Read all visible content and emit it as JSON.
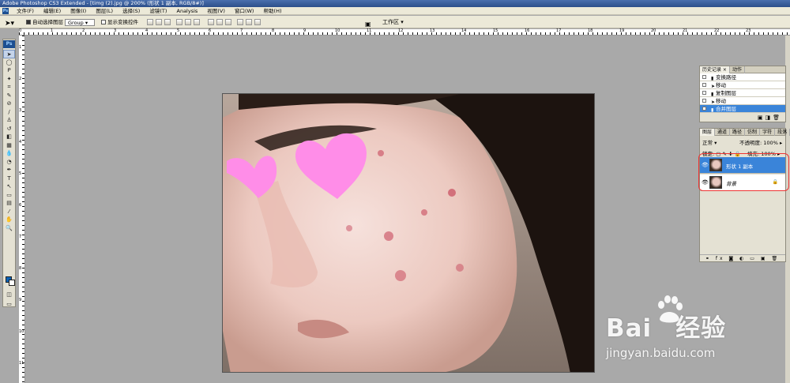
{
  "window": {
    "title": "Adobe Photoshop CS3 Extended - [timg (2).jpg @ 200% (形状 1 副本, RGB/8#)]"
  },
  "menu": [
    "文件(F)",
    "编辑(E)",
    "图像(I)",
    "图层(L)",
    "选择(S)",
    "滤镜(T)",
    "Analysis",
    "视图(V)",
    "窗口(W)",
    "帮助(H)"
  ],
  "options": {
    "auto_select_label": "自动选择图层",
    "auto_select_value": "Group",
    "show_transform_label": "显示变换控件",
    "workspace_label": "工作区 ▾"
  },
  "rulers": {
    "h": [
      "0",
      "1",
      "2",
      "3",
      "4",
      "5",
      "6",
      "7",
      "8",
      "9",
      "10",
      "11",
      "12",
      "13",
      "14",
      "15",
      "16",
      "17",
      "18",
      "19",
      "20",
      "21",
      "22",
      "23"
    ],
    "v": [
      "1",
      "2",
      "3",
      "4",
      "5",
      "6",
      "7",
      "8",
      "9",
      "10",
      "11"
    ]
  },
  "history": {
    "tabs": [
      "历史记录",
      "动作"
    ],
    "items": [
      {
        "label": "变换路径",
        "selected": false
      },
      {
        "label": "移动",
        "selected": false
      },
      {
        "label": "复制图层",
        "selected": false
      },
      {
        "label": "移动",
        "selected": false
      },
      {
        "label": "合并图层",
        "selected": true
      }
    ]
  },
  "layers_panel": {
    "tabs": [
      "图层",
      "通道",
      "路径",
      "仿制",
      "字符",
      "段落"
    ],
    "blend_mode": "正常",
    "opacity_label": "不透明度:",
    "opacity_value": "100%",
    "lock_label": "锁定:",
    "fill_label": "填充:",
    "fill_value": "100%",
    "layers": [
      {
        "name": "形状 1 副本",
        "selected": true,
        "locked": false
      },
      {
        "name": "背景",
        "selected": false,
        "locked": true
      }
    ]
  },
  "watermark": {
    "brand": "Bai",
    "brand2": "经验",
    "url": "jingyan.baidu.com"
  },
  "colors": {
    "accent": "#3a84d9",
    "heart": "#ff8de8",
    "annotation": "#ee3333"
  }
}
